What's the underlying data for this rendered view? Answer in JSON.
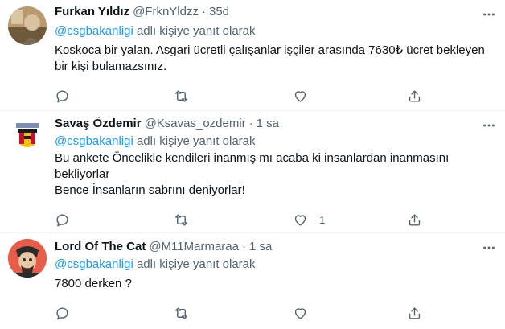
{
  "tweets": [
    {
      "name": "Furkan Yıldız",
      "handle": "@FrknYldzz",
      "time": "35d",
      "reply_prefix": "",
      "reply_mention": "@csgbakanligi",
      "reply_suffix": " adlı kişiye yanıt olarak",
      "lines": [
        "Koskoca bir yalan. Asgari ücretli çalışanlar işçiler arasında 7630₺ ücret bekleyen",
        "bir kişi bulamazsınız."
      ],
      "reply_count": "",
      "retweet_count": "",
      "like_count": ""
    },
    {
      "name": "Savaş Özdemir",
      "handle": "@Ksavas_ozdemir",
      "time": "1 sa",
      "reply_prefix": "",
      "reply_mention": "@csgbakanligi",
      "reply_suffix": " adlı kişiye yanıt olarak",
      "lines": [
        "Bu ankete Öncelikle kendileri inanmış mı acaba ki insanlardan inanmasını",
        "bekliyorlar",
        "Bence İnsanların sabrını deniyorlar!"
      ],
      "reply_count": "",
      "retweet_count": "",
      "like_count": "1"
    },
    {
      "name": "Lord Of The Cat",
      "handle": "@M11Marmaraa",
      "time": "1 sa",
      "reply_prefix": "",
      "reply_mention": "@csgbakanligi",
      "reply_suffix": " adlı kişiye yanıt olarak",
      "lines": [
        "7800 derken ?"
      ],
      "reply_count": "",
      "retweet_count": "",
      "like_count": ""
    }
  ],
  "separator": "·",
  "icons": {
    "more": "more-icon",
    "reply": "reply-icon",
    "retweet": "retweet-icon",
    "like": "like-icon",
    "share": "share-icon"
  },
  "colors": {
    "link": "#1d9bf0",
    "secondary": "#536471",
    "text": "#0f1419",
    "border": "#eff3f4"
  }
}
